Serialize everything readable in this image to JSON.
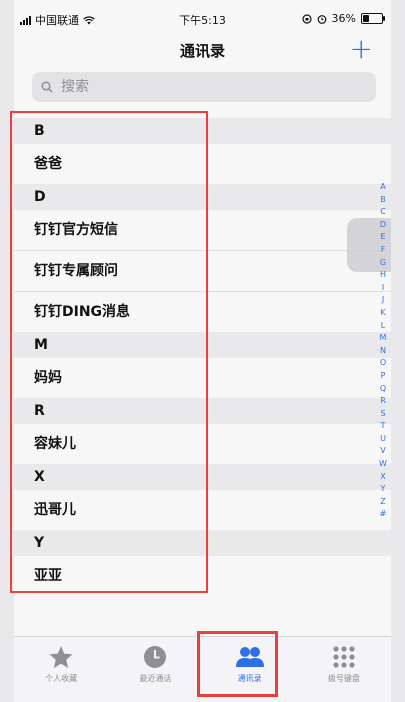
{
  "status": {
    "carrier": "中国联通",
    "time": "下午5:13",
    "battery": "36%",
    "battery_level": 0.36
  },
  "nav": {
    "title": "通讯录",
    "add_label": "+"
  },
  "search": {
    "placeholder": "搜索"
  },
  "contacts": [
    {
      "section": "B",
      "names": [
        "爸爸"
      ]
    },
    {
      "section": "D",
      "names": [
        "钉钉官方短信",
        "钉钉专属顾问",
        "钉钉DING消息"
      ]
    },
    {
      "section": "M",
      "names": [
        "妈妈"
      ]
    },
    {
      "section": "R",
      "names": [
        "容妹儿"
      ]
    },
    {
      "section": "X",
      "names": [
        "迅哥儿"
      ]
    },
    {
      "section": "Y",
      "names": [
        "亚亚"
      ]
    }
  ],
  "index_letters": [
    "A",
    "B",
    "C",
    "D",
    "E",
    "F",
    "G",
    "H",
    "I",
    "J",
    "K",
    "L",
    "M",
    "N",
    "O",
    "P",
    "Q",
    "R",
    "S",
    "T",
    "U",
    "V",
    "W",
    "X",
    "Y",
    "Z",
    "#"
  ],
  "tabs": [
    {
      "label": "个人收藏",
      "icon": "star-icon",
      "active": false
    },
    {
      "label": "最近通话",
      "icon": "clock-icon",
      "active": false
    },
    {
      "label": "通讯录",
      "icon": "contacts-icon",
      "active": true
    },
    {
      "label": "拨号键盘",
      "icon": "keypad-icon",
      "active": false
    }
  ],
  "colors": {
    "accent": "#2f6fe6",
    "highlight": "#e8403f"
  }
}
